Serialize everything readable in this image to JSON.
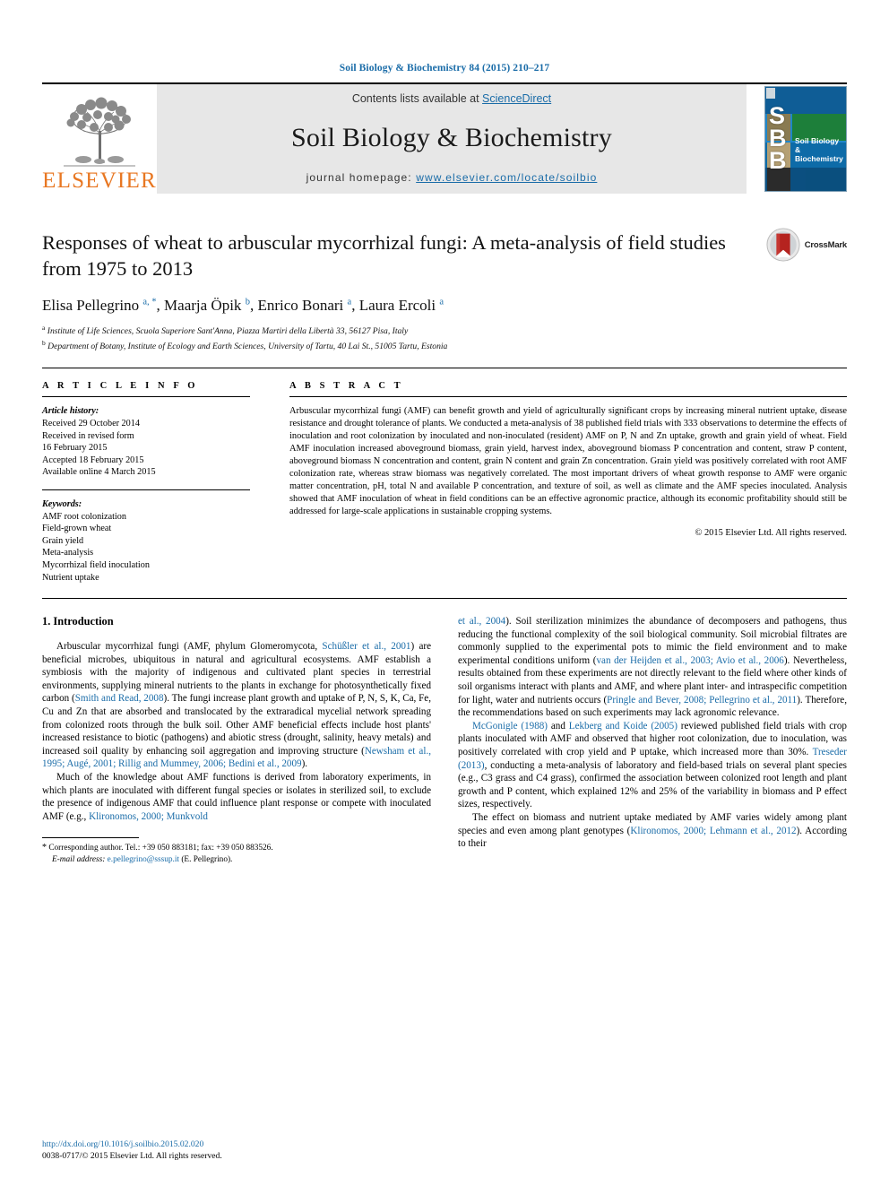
{
  "running_head": "Soil Biology & Biochemistry 84 (2015) 210–217",
  "masthead": {
    "publisher_name": "ELSEVIER",
    "contents_prefix": "Contents lists available at ",
    "contents_link": "ScienceDirect",
    "journal_title": "Soil Biology & Biochemistry",
    "homepage_prefix": "journal homepage: ",
    "homepage_url": "www.elsevier.com/locate/soilbio",
    "cover_initials": "S\nB\nB",
    "cover_title": "Soil Biology &\nBiochemistry"
  },
  "article": {
    "title": "Responses of wheat to arbuscular mycorrhizal fungi: A meta-analysis of field studies from 1975 to 2013",
    "crossmark_label": "CrossMark",
    "authors_html": "Elisa Pellegrino <sup>a, *</sup>, Maarja Öpik <sup>b</sup>, Enrico Bonari <sup>a</sup>, Laura Ercoli <sup>a</sup>",
    "affiliations": [
      "Institute of Life Sciences, Scuola Superiore Sant'Anna, Piazza Martiri della Libertà 33, 56127 Pisa, Italy",
      "Department of Botany, Institute of Ecology and Earth Sciences, University of Tartu, 40 Lai St., 51005 Tartu, Estonia"
    ],
    "affiliation_marks": [
      "a",
      "b"
    ]
  },
  "info": {
    "heading": "A R T I C L E   I N F O",
    "history_label": "Article history:",
    "history": [
      "Received 29 October 2014",
      "Received in revised form",
      "16 February 2015",
      "Accepted 18 February 2015",
      "Available online 4 March 2015"
    ],
    "keywords_label": "Keywords:",
    "keywords": [
      "AMF root colonization",
      "Field-grown wheat",
      "Grain yield",
      "Meta-analysis",
      "Mycorrhizal field inoculation",
      "Nutrient uptake"
    ]
  },
  "abstract": {
    "heading": "A B S T R A C T",
    "text": "Arbuscular mycorrhizal fungi (AMF) can benefit growth and yield of agriculturally significant crops by increasing mineral nutrient uptake, disease resistance and drought tolerance of plants. We conducted a meta-analysis of 38 published field trials with 333 observations to determine the effects of inoculation and root colonization by inoculated and non-inoculated (resident) AMF on P, N and Zn uptake, growth and grain yield of wheat. Field AMF inoculation increased aboveground biomass, grain yield, harvest index, aboveground biomass P concentration and content, straw P content, aboveground biomass N concentration and content, grain N content and grain Zn concentration. Grain yield was positively correlated with root AMF colonization rate, whereas straw biomass was negatively correlated. The most important drivers of wheat growth response to AMF were organic matter concentration, pH, total N and available P concentration, and texture of soil, as well as climate and the AMF species inoculated. Analysis showed that AMF inoculation of wheat in field conditions can be an effective agronomic practice, although its economic profitability should still be addressed for large-scale applications in sustainable cropping systems.",
    "copyright": "© 2015 Elsevier Ltd. All rights reserved."
  },
  "introduction": {
    "section_number_title": "1. Introduction",
    "left_paragraphs": [
      {
        "segments": [
          {
            "t": "Arbuscular mycorrhizal fungi (AMF, phylum Glomeromycota, ",
            "link": false
          },
          {
            "t": "Schüßler et al., 2001",
            "link": true
          },
          {
            "t": ") are beneficial microbes, ubiquitous in natural and agricultural ecosystems. AMF establish a symbiosis with the majority of indigenous and cultivated plant species in terrestrial environments, supplying mineral nutrients to the plants in exchange for photosynthetically fixed carbon (",
            "link": false
          },
          {
            "t": "Smith and Read, 2008",
            "link": true
          },
          {
            "t": "). The fungi increase plant growth and uptake of P, N, S, K, Ca, Fe, Cu and Zn that are absorbed and translocated by the extraradical mycelial network spreading from colonized roots through the bulk soil. Other AMF beneficial effects include host plants' increased resistance to biotic (pathogens) and abiotic stress (drought, salinity, heavy metals) and increased soil quality by enhancing soil aggregation and improving structure (",
            "link": false
          },
          {
            "t": "Newsham et al., 1995; Augé, 2001; Rillig and Mummey, 2006; Bedini et al., 2009",
            "link": true
          },
          {
            "t": ").",
            "link": false
          }
        ]
      },
      {
        "segments": [
          {
            "t": "Much of the knowledge about AMF functions is derived from laboratory experiments, in which plants are inoculated with different fungal species or isolates in sterilized soil, to exclude the presence of indigenous AMF that could influence plant response or compete with inoculated AMF (e.g., ",
            "link": false
          },
          {
            "t": "Klironomos, 2000; Munkvold",
            "link": true
          }
        ]
      }
    ],
    "right_paragraphs": [
      {
        "segments": [
          {
            "t": "et al., 2004",
            "link": true
          },
          {
            "t": "). Soil sterilization minimizes the abundance of decomposers and pathogens, thus reducing the functional complexity of the soil biological community. Soil microbial filtrates are commonly supplied to the experimental pots to mimic the field environment and to make experimental conditions uniform (",
            "link": false
          },
          {
            "t": "van der Heijden et al., 2003; Avio et al., 2006",
            "link": true
          },
          {
            "t": "). Nevertheless, results obtained from these experiments are not directly relevant to the field where other kinds of soil organisms interact with plants and AMF, and where plant inter- and intraspecific competition for light, water and nutrients occurs (",
            "link": false
          },
          {
            "t": "Pringle and Bever, 2008; Pellegrino et al., 2011",
            "link": true
          },
          {
            "t": "). Therefore, the recommendations based on such experiments may lack agronomic relevance.",
            "link": false
          }
        ],
        "no_indent": true
      },
      {
        "segments": [
          {
            "t": "McGonigle (1988)",
            "link": true
          },
          {
            "t": " and ",
            "link": false
          },
          {
            "t": "Lekberg and Koide (2005)",
            "link": true
          },
          {
            "t": " reviewed published field trials with crop plants inoculated with AMF and observed that higher root colonization, due to inoculation, was positively correlated with crop yield and P uptake, which increased more than 30%. ",
            "link": false
          },
          {
            "t": "Treseder (2013)",
            "link": true
          },
          {
            "t": ", conducting a meta-analysis of laboratory and field-based trials on several plant species (e.g., C3 grass and C4 grass), confirmed the association between colonized root length and plant growth and P content, which explained 12% and 25% of the variability in biomass and P effect sizes, respectively.",
            "link": false
          }
        ]
      },
      {
        "segments": [
          {
            "t": "The effect on biomass and nutrient uptake mediated by AMF varies widely among plant species and even among plant genotypes (",
            "link": false
          },
          {
            "t": "Klironomos, 2000; Lehmann et al., 2012",
            "link": true
          },
          {
            "t": "). According to their",
            "link": false
          }
        ]
      }
    ]
  },
  "footnote": {
    "star": "*",
    "corresponding": "Corresponding author. Tel.: +39 050 883181; fax: +39 050 883526.",
    "email_label": "E-mail address:",
    "email": "e.pellegrino@sssup.it",
    "email_suffix": "(E. Pellegrino)."
  },
  "bottom_meta": {
    "doi": "http://dx.doi.org/10.1016/j.soilbio.2015.02.020",
    "issn_line": "0038-0717/© 2015 Elsevier Ltd. All rights reserved."
  },
  "colors": {
    "link_blue": "#1a6ca8",
    "elsevier_orange": "#E87722",
    "banner_gray": "#e7e7e7",
    "cover_blue": "#1273ba"
  }
}
